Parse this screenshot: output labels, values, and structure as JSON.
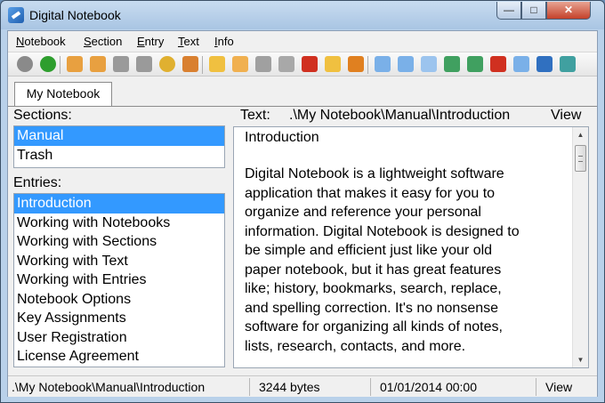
{
  "window": {
    "title": "Digital Notebook",
    "min_glyph": "—",
    "max_glyph": "□",
    "close_glyph": "✕"
  },
  "menu": [
    "Notebook",
    "Section",
    "Entry",
    "Text",
    "Info"
  ],
  "toolbar": [
    {
      "icon": "back-icon",
      "color": "#8a8a8a",
      "shape": "round"
    },
    {
      "icon": "forward-icon",
      "color": "#2e9e2e",
      "shape": "round"
    },
    {
      "icon": "bookmark-prev-icon",
      "color": "#e8a040"
    },
    {
      "icon": "bookmark-next-icon",
      "color": "#e8a040"
    },
    {
      "icon": "history-back-icon",
      "color": "#9a9a9a"
    },
    {
      "icon": "history-forward-icon",
      "color": "#9a9a9a"
    },
    {
      "icon": "refresh-icon",
      "color": "#e0b030",
      "shape": "round"
    },
    {
      "icon": "book-icon",
      "color": "#d98030"
    },
    {
      "icon": "new-notebook-icon",
      "color": "#f0c040"
    },
    {
      "icon": "rename-notebook-icon",
      "color": "#f0b050"
    },
    {
      "icon": "close-notebook-icon",
      "color": "#a0a0a0"
    },
    {
      "icon": "save-notebook-icon",
      "color": "#a8a8a8"
    },
    {
      "icon": "delete-notebook-icon",
      "color": "#d03020"
    },
    {
      "icon": "open-folder-icon",
      "color": "#f0c040"
    },
    {
      "icon": "export-icon",
      "color": "#e08020"
    },
    {
      "icon": "new-entry-icon",
      "color": "#7ab0e8"
    },
    {
      "icon": "rename-entry-icon",
      "color": "#7ab0e8"
    },
    {
      "icon": "copy-entry-icon",
      "color": "#9cc4ee"
    },
    {
      "icon": "move-entry-icon",
      "color": "#40a060"
    },
    {
      "icon": "sync-entry-icon",
      "color": "#40a060"
    },
    {
      "icon": "delete-entry-icon",
      "color": "#d03020"
    },
    {
      "icon": "properties-icon",
      "color": "#7ab0e8"
    },
    {
      "icon": "car-icon",
      "color": "#3070c0"
    },
    {
      "icon": "paste-entry-icon",
      "color": "#40a0a0"
    }
  ],
  "tab": {
    "label": "My Notebook"
  },
  "sections": {
    "label": "Sections:",
    "items": [
      "Manual",
      "Trash"
    ],
    "selected": 0
  },
  "entries": {
    "label": "Entries:",
    "items": [
      "Introduction",
      "Working with Notebooks",
      "Working with Sections",
      "Working with Text",
      "Working with Entries",
      "Notebook Options",
      "Key Assignments",
      "User Registration",
      "License Agreement"
    ],
    "selected": 0
  },
  "text_header": {
    "label": "Text:",
    "path": ".\\My Notebook\\Manual\\Introduction",
    "view": "View"
  },
  "text_content": {
    "heading": "Introduction",
    "lines": [
      "Digital Notebook is a lightweight software",
      "application that makes it easy for you to",
      "organize and reference your personal",
      "information. Digital Notebook is designed to",
      "be simple and efficient just like your old",
      "paper notebook, but it has great features",
      "like; history, bookmarks, search, replace,",
      "and spelling correction. It's no nonsense",
      "software for organizing all kinds of notes,",
      "lists, research, contacts, and more."
    ]
  },
  "scrollbar": {
    "up_glyph": "▲",
    "down_glyph": "▼"
  },
  "status": {
    "path": ".\\My Notebook\\Manual\\Introduction",
    "size": "3244 bytes",
    "date": "01/01/2014 00:00",
    "view": "View"
  }
}
